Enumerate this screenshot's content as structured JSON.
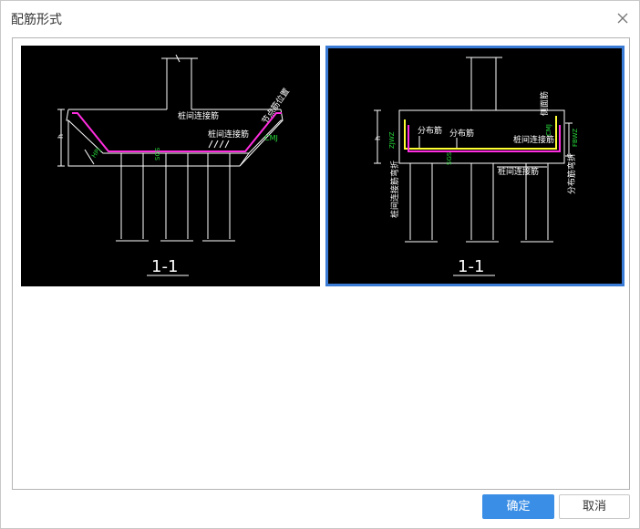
{
  "dialog": {
    "title": "配筋形式"
  },
  "option_a": {
    "label_top": "桩间连接筋",
    "label_mid": "桩间连接筋",
    "label_diag": "节点筋位置",
    "label_cmj": "CMJ",
    "label_hpj": "HPJ",
    "label_sgs": "SGS",
    "label_h": "h",
    "section": "1-1"
  },
  "option_b": {
    "label_dist1": "分布筋",
    "label_dist2": "分布筋",
    "label_side": "侧面筋",
    "label_conn1": "桩间连接筋",
    "label_conn2": "桩间连接筋",
    "label_left_vert": "桩间连接筋弯折",
    "label_right_vert": "分布筋弯折",
    "label_zjwz": "ZJWZ",
    "label_fbwz": "FBWZ",
    "label_cmj": "CMJ",
    "label_sgs": "SGS",
    "label_h": "h",
    "section": "1-1"
  },
  "buttons": {
    "ok": "确定",
    "cancel": "取消"
  },
  "colors": {
    "accent": "#3a8ee6",
    "selected_border": "#3a7bd5"
  },
  "icons": {
    "close": "close-icon"
  }
}
